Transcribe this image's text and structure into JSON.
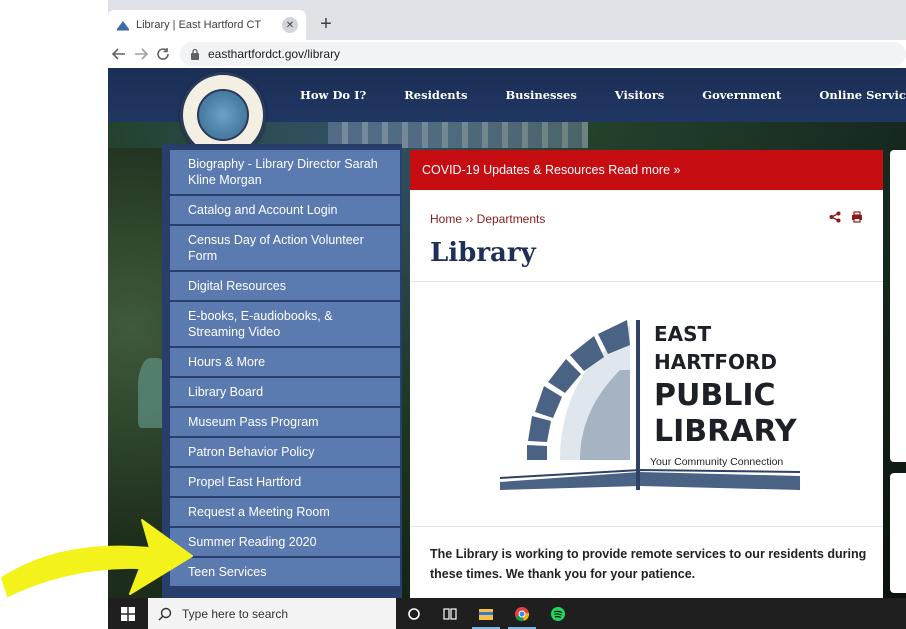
{
  "browser": {
    "tab_title": "Library | East Hartford CT",
    "tab_close": "✕",
    "new_tab": "+",
    "url": "easthartfordct.gov/library"
  },
  "nav": {
    "menu": [
      "How Do I?",
      "Residents",
      "Businesses",
      "Visitors",
      "Government",
      "Online Services"
    ]
  },
  "sidebar": {
    "items": [
      {
        "label": "Biography - Library Director Sarah Kline Morgan"
      },
      {
        "label": "Catalog and Account Login"
      },
      {
        "label": "Census Day of Action Volunteer Form"
      },
      {
        "label": "Digital Resources"
      },
      {
        "label": "E-books, E-audiobooks, & Streaming Video"
      },
      {
        "label": "Hours & More"
      },
      {
        "label": "Library Board"
      },
      {
        "label": "Museum Pass Program"
      },
      {
        "label": "Patron Behavior Policy"
      },
      {
        "label": "Propel East Hartford"
      },
      {
        "label": "Request a Meeting Room"
      },
      {
        "label": "Summer Reading 2020"
      },
      {
        "label": "Teen Services"
      }
    ]
  },
  "main": {
    "alert": "COVID-19 Updates & Resources Read more »",
    "breadcrumb": "Home ›› Departments",
    "title": "Library",
    "logo": {
      "line1": "EAST",
      "line2": "HARTFORD",
      "line3": "PUBLIC",
      "line4": "LIBRARY",
      "tagline": "Your Community Connection"
    },
    "intro": "The Library is working to provide remote services to our residents during these times. We thank you for your patience."
  },
  "taskbar": {
    "search_placeholder": "Type here to search"
  },
  "colors": {
    "nav_bg": "#1b2e55",
    "sidebar_item": "#5b7bb0",
    "alert_red": "#c50d12",
    "breadcrumb": "#8b1a1a",
    "title": "#1f2f55",
    "arrow_yellow": "#f3f21a"
  },
  "icons": [
    "favicon-icon",
    "back-icon",
    "forward-icon",
    "reload-icon",
    "lock-icon",
    "share-icon",
    "print-icon",
    "windows-start-icon",
    "search-icon",
    "task-view-icon",
    "file-explorer-icon",
    "chrome-icon",
    "spotify-icon",
    "cortana-icon"
  ]
}
